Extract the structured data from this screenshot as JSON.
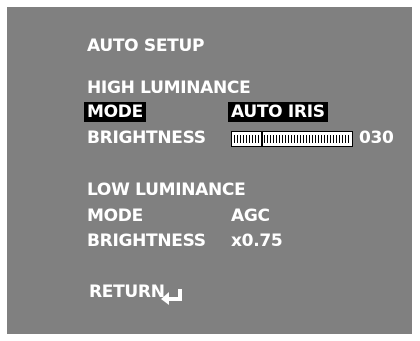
{
  "menu": {
    "title": "AUTO SETUP",
    "high": {
      "heading": "HIGH LUMINANCE",
      "mode_label": "MODE",
      "mode_value": "AUTO IRIS",
      "brightness_label": "BRIGHTNESS",
      "brightness_value": "030",
      "brightness_level": 0.23
    },
    "low": {
      "heading": "LOW LUMINANCE",
      "mode_label": "MODE",
      "mode_value": "AGC",
      "brightness_label": "BRIGHTNESS",
      "brightness_value": "x0.75"
    },
    "return_label": "RETURN",
    "return_icon": "return-arrow-icon",
    "colors": {
      "background": "#808080",
      "text": "#ffffff",
      "highlight": "#000000"
    }
  }
}
